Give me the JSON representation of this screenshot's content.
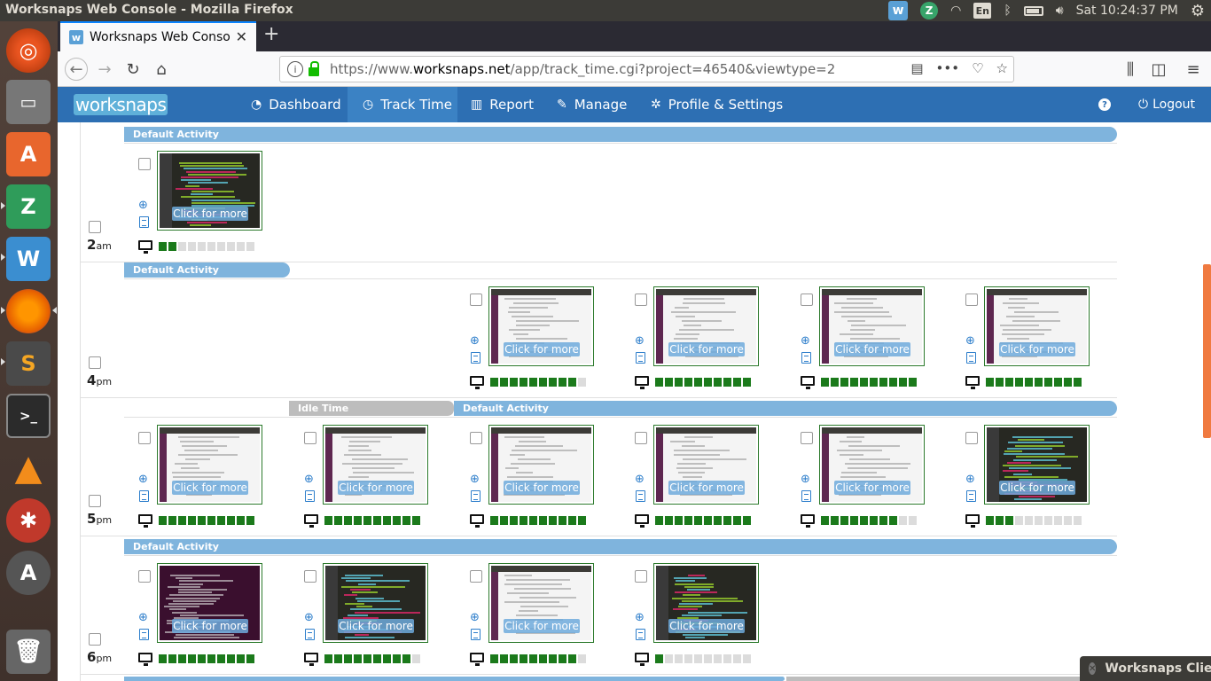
{
  "os": {
    "window_title": "Worksnaps Web Console - Mozilla Firefox",
    "clock": "Sat 10:24:37 PM",
    "keyboard_layout": "En",
    "tray_icons": [
      "worksnaps-icon",
      "zoom-z-icon",
      "wifi-icon",
      "keyboard-icon",
      "bluetooth-icon",
      "battery-icon",
      "volume-icon",
      "settings-gear-icon"
    ]
  },
  "launcher": {
    "items": [
      {
        "name": "ubuntu-logo",
        "label": "◎"
      },
      {
        "name": "files",
        "label": "▭"
      },
      {
        "name": "software-center",
        "label": "A"
      },
      {
        "name": "zotero",
        "label": "Z"
      },
      {
        "name": "worksnaps",
        "label": "W"
      },
      {
        "name": "firefox",
        "label": "🦊"
      },
      {
        "name": "sublime-text",
        "label": "S"
      },
      {
        "name": "terminal",
        "label": ">_"
      },
      {
        "name": "vlc",
        "label": "▲"
      },
      {
        "name": "network-tool",
        "label": "✱"
      },
      {
        "name": "software-updater",
        "label": "A"
      },
      {
        "name": "trash",
        "label": "🗑"
      }
    ]
  },
  "browser": {
    "tab_title": "Worksnaps Web Console",
    "url_prefix": "https://www.",
    "url_domain": "worksnaps.net",
    "url_path": "/app/track_time.cgi?project=46540&viewtype=2"
  },
  "nav": {
    "logo": "worksnaps",
    "items": [
      {
        "icon": "dashboard-icon",
        "glyph": "◔",
        "label": "Dashboard",
        "active": false
      },
      {
        "icon": "clock-icon",
        "glyph": "◷",
        "label": "Track Time",
        "active": true
      },
      {
        "icon": "report-icon",
        "glyph": "▥",
        "label": "Report",
        "active": false
      },
      {
        "icon": "wrench-icon",
        "glyph": "✎",
        "label": "Manage",
        "active": false
      },
      {
        "icon": "gear-icon",
        "glyph": "✲",
        "label": "Profile & Settings",
        "active": false
      }
    ],
    "help_glyph": "?",
    "logout": "Logout"
  },
  "rows": [
    {
      "hour": "2",
      "suffix": "am",
      "activities": [
        {
          "label": "Default Activity",
          "type": "default"
        }
      ]
    },
    {
      "hour": "4",
      "suffix": "pm",
      "activities": [
        {
          "label": "Default Activity",
          "type": "default"
        }
      ]
    },
    {
      "hour": "5",
      "suffix": "pm",
      "activities": [
        {
          "label": "Idle Time",
          "type": "idle"
        },
        {
          "label": "Default Activity",
          "type": "default"
        }
      ]
    },
    {
      "hour": "6",
      "suffix": "pm",
      "activities": [
        {
          "label": "Default Activity",
          "type": "default"
        }
      ]
    }
  ],
  "snapshot_label": "Click for more",
  "snapshots": [
    {
      "row": 0,
      "slot": 0,
      "screen": "code",
      "activity_level": 2
    },
    {
      "row": 1,
      "slot": 2,
      "screen": "web",
      "activity_level": 9
    },
    {
      "row": 1,
      "slot": 3,
      "screen": "web",
      "activity_level": 10
    },
    {
      "row": 1,
      "slot": 4,
      "screen": "web",
      "activity_level": 10
    },
    {
      "row": 1,
      "slot": 5,
      "screen": "web",
      "activity_level": 10
    },
    {
      "row": 2,
      "slot": 0,
      "screen": "web",
      "activity_level": 10
    },
    {
      "row": 2,
      "slot": 1,
      "screen": "web",
      "activity_level": 10
    },
    {
      "row": 2,
      "slot": 2,
      "screen": "web",
      "activity_level": 10
    },
    {
      "row": 2,
      "slot": 3,
      "screen": "web",
      "activity_level": 10
    },
    {
      "row": 2,
      "slot": 4,
      "screen": "web",
      "activity_level": 8
    },
    {
      "row": 2,
      "slot": 5,
      "screen": "code",
      "activity_level": 3
    },
    {
      "row": 3,
      "slot": 0,
      "screen": "term",
      "activity_level": 10
    },
    {
      "row": 3,
      "slot": 1,
      "screen": "code",
      "activity_level": 9
    },
    {
      "row": 3,
      "slot": 2,
      "screen": "web",
      "activity_level": 9
    },
    {
      "row": 3,
      "slot": 3,
      "screen": "code",
      "activity_level": 1
    }
  ],
  "notification": "Worksnaps Client"
}
